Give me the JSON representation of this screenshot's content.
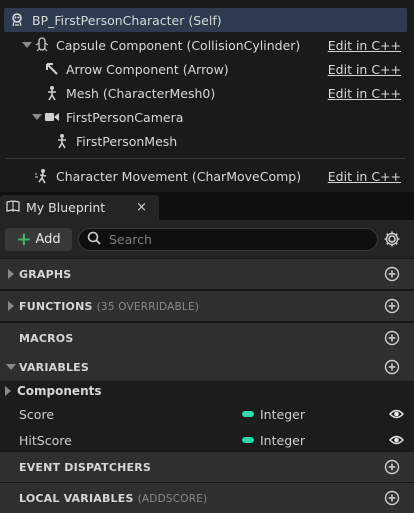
{
  "components": {
    "root": {
      "label": "BP_FirstPersonCharacter (Self)",
      "icon": "pawn-icon"
    },
    "items": [
      {
        "label": "Capsule Component (CollisionCylinder)",
        "edit": "Edit in C++",
        "icon": "capsule-icon"
      },
      {
        "label": "Arrow Component (Arrow)",
        "edit": "Edit in C++",
        "icon": "arrow-component-icon"
      },
      {
        "label": "Mesh (CharacterMesh0)",
        "edit": "Edit in C++",
        "icon": "skeletal-mesh-icon"
      },
      {
        "label": "FirstPersonCamera",
        "edit": "",
        "icon": "camera-icon"
      },
      {
        "label": "FirstPersonMesh",
        "edit": "",
        "icon": "skeletal-mesh-icon"
      },
      {
        "label": "Character Movement (CharMoveComp)",
        "edit": "Edit in C++",
        "icon": "movement-icon"
      }
    ]
  },
  "tab": {
    "label": "My Blueprint",
    "close": "×"
  },
  "toolbar": {
    "add_label": "Add",
    "search_placeholder": "Search"
  },
  "sections": {
    "graphs": {
      "title": "GRAPHS"
    },
    "functions": {
      "title": "FUNCTIONS",
      "subtitle": "(35 OVERRIDABLE)"
    },
    "macros": {
      "title": "MACROS"
    },
    "variables": {
      "title": "VARIABLES"
    },
    "event_dispatchers": {
      "title": "EVENT DISPATCHERS"
    },
    "local_variables": {
      "title": "LOCAL VARIABLES",
      "subtitle": "(ADDSCORE)"
    }
  },
  "variables": {
    "category": "Components",
    "items": [
      {
        "name": "Score",
        "type": "Integer",
        "type_color": "#2fd7a8"
      },
      {
        "name": "HitScore",
        "type": "Integer",
        "type_color": "#2fd7a8"
      }
    ]
  },
  "colors": {
    "selection": "#2d3a4f",
    "add_accent": "#3fb86a",
    "integer_pin": "#2fd7a8"
  }
}
